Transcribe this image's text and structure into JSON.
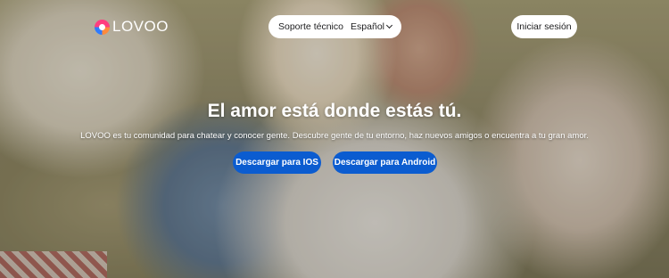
{
  "brand": {
    "name": "LOVOO",
    "accent": "#0b5cd0"
  },
  "nav": {
    "support_label": "Soporte técnico",
    "language_label": "Español",
    "login_label": "Iniciar sesión"
  },
  "hero": {
    "headline": "El amor está donde estás tú.",
    "subtitle": "LOVOO es tu comunidad para chatear y conocer gente. Descubre gente de tu entorno, haz nuevos amigos o encuentra a tu gran amor.",
    "ios_button": "Descargar para IOS",
    "android_button": "Descargar para Android"
  }
}
